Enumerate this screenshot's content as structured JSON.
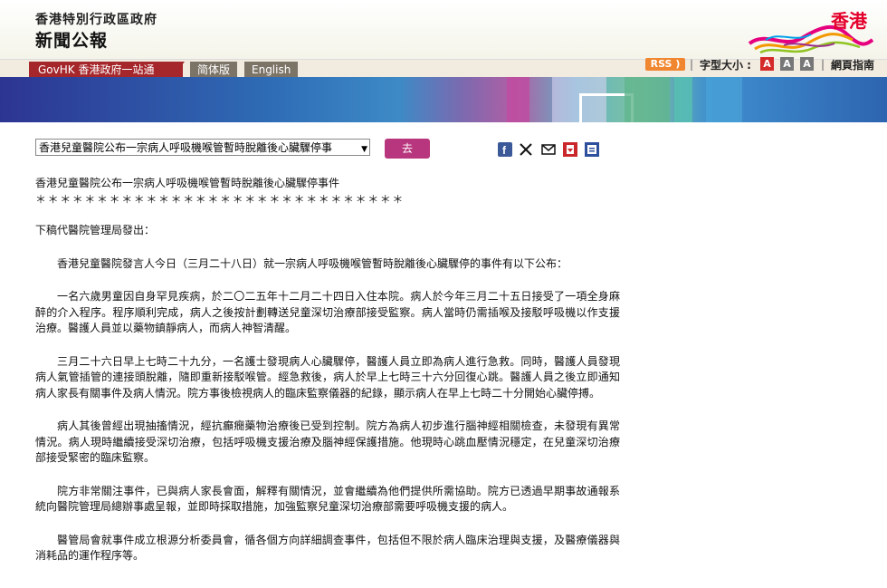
{
  "header": {
    "gov_name": "香港特別行政區政府",
    "site_title": "新聞公報",
    "logo_text": "香港"
  },
  "nav": {
    "govhk": "GovHK 香港政府一站通",
    "simplified": "简体版",
    "english": "English",
    "rss": "RSS",
    "font_size_label": "字型大小 :",
    "font_sizes": [
      "A",
      "A",
      "A"
    ],
    "sitemap": "網頁指南"
  },
  "selector": {
    "selected": "香港兒童醫院公布一宗病人呼吸機喉管暫時脫離後心臟驟停事",
    "go": "去"
  },
  "share": [
    "facebook-icon",
    "x-icon",
    "email-icon",
    "bookmark-icon",
    "print-icon"
  ],
  "article": {
    "title": "香港兒童醫院公布一宗病人呼吸機喉管暫時脫離後心臟驟停事件",
    "stars": "＊＊＊＊＊＊＊＊＊＊＊＊＊＊＊＊＊＊＊＊＊＊＊＊＊＊＊＊＊＊",
    "sender": "下稿代醫院管理局發出：",
    "paragraphs": [
      "香港兒童醫院發言人今日（三月二十八日）就一宗病人呼吸機喉管暫時脫離後心臟驟停的事件有以下公布：",
      "一名六歲男童因自身罕見疾病，於二〇二五年十二月二十四日入住本院。病人於今年三月二十五日接受了一項全身麻醉的介入程序。程序順利完成，病人之後按計劃轉送兒童深切治療部接受監察。病人當時仍需插喉及接駁呼吸機以作支援治療。醫護人員並以藥物鎮靜病人，而病人神智清醒。",
      "三月二十六日早上七時二十九分，一名護士發現病人心臟驟停，醫護人員立即為病人進行急救。同時，醫護人員發現病人氣管插管的連接頭脫離，隨即重新接駁喉管。經急救後，病人於早上七時三十六分回復心跳。醫護人員之後立即通知病人家長有關事件及病人情況。院方事後檢視病人的臨床監察儀器的紀錄，顯示病人在早上七時二十分開始心臟停搏。",
      "病人其後曾經出現抽搐情況，經抗癲癇藥物治療後已受到控制。院方為病人初步進行腦神經相關檢查，未發現有異常情況。病人現時繼續接受深切治療，包括呼吸機支援治療及腦神經保護措施。他現時心跳血壓情況穩定，在兒童深切治療部接受緊密的臨床監察。",
      "院方非常關注事件，已與病人家長會面，解釋有關情況，並會繼續為他們提供所需協助。院方已透過早期事故通報系統向醫院管理局總辦事處呈報，並即時採取措施，加強監察兒童深切治療部需要呼吸機支援的病人。",
      "醫管局會就事件成立根源分析委員會，循各個方向詳細調查事件，包括但不限於病人臨床治理與支援，及醫療儀器與消耗品的運作程序等。"
    ]
  },
  "colors": {
    "govhk_red": "#a5262b",
    "go_button": "#b8367e",
    "rss_orange": "#f0862f",
    "fontsize_red": "#d42a2a",
    "fontsize_grey": "#777777"
  }
}
